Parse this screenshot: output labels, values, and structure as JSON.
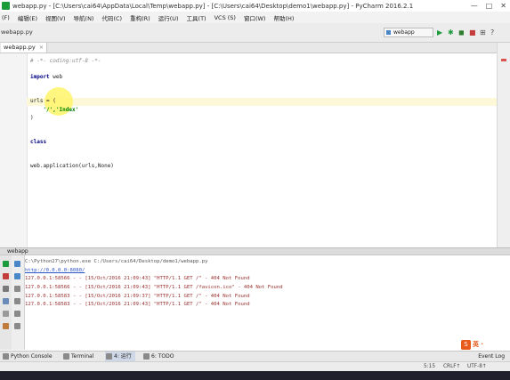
{
  "titlebar": {
    "title": "webapp.py - [C:\\Users\\cai64\\AppData\\Local\\Temp\\webapp.py] - [C:\\Users\\cai64\\Desktop\\demo1\\webapp.py] - PyCharm 2016.2.1",
    "buttons": [
      "—",
      "□",
      "✕"
    ]
  },
  "menubar": [
    "(F)",
    "编辑(E)",
    "视图(V)",
    "导航(N)",
    "代码(C)",
    "重构(R)",
    "运行(U)",
    "工具(T)",
    "VCS (S)",
    "窗口(W)",
    "帮助(H)"
  ],
  "toolbar": {
    "breadcrumb": "webapp.py",
    "run_config": "webapp",
    "icons": [
      "run-icon",
      "debug-icon",
      "coverage-icon",
      "stop-icon",
      "vcs-icon",
      "settings-icon"
    ]
  },
  "editor": {
    "tab_label": "webapp.py",
    "tab_close": "×",
    "lines": [
      {
        "kind": "comment",
        "text": "# -*- coding:utf-8 -*-"
      },
      {
        "kind": "blank",
        "text": ""
      },
      {
        "kind": "import",
        "kw": "import",
        "rest": " web"
      },
      {
        "kind": "blank",
        "text": ""
      },
      {
        "kind": "blank",
        "text": ""
      },
      {
        "kind": "plain",
        "text": "urls = ("
      },
      {
        "kind": "string",
        "text": "    '/','Index'"
      },
      {
        "kind": "plain",
        "text": ")"
      },
      {
        "kind": "blank",
        "text": ""
      },
      {
        "kind": "blank",
        "text": ""
      },
      {
        "kind": "class",
        "kw": "class",
        "rest": " "
      },
      {
        "kind": "blank",
        "text": ""
      },
      {
        "kind": "blank",
        "text": ""
      },
      {
        "kind": "plain",
        "text": "web.application(urls,None)"
      }
    ]
  },
  "run_panel": {
    "header": "webapp",
    "lines": [
      {
        "kind": "plain",
        "text": "C:\\Python27\\python.exe C:/Users/cai64/Desktop/demo1/webapp.py"
      },
      {
        "kind": "link",
        "text": "http://0.0.0.0:8080/"
      },
      {
        "kind": "err",
        "text": "127.0.0.1:58566 - - [15/Oct/2016 21:09:43] \"HTTP/1.1 GET /\" - 404 Not Found"
      },
      {
        "kind": "err",
        "text": "127.0.0.1:58566 - - [15/Oct/2016 21:09:43] \"HTTP/1.1 GET /favicon.ico\" - 404 Not Found"
      },
      {
        "kind": "err",
        "text": "127.0.0.1:58583 - - [15/Oct/2016 21:09:37] \"HTTP/1.1 GET /\" - 404 Not Found"
      },
      {
        "kind": "err",
        "text": "127.0.0.1:58583 - - [15/Oct/2016 21:09:43] \"HTTP/1.1 GET /\" - 404 Not Found"
      }
    ]
  },
  "bottom_tabs": [
    {
      "label": "Python Console",
      "active": false
    },
    {
      "label": "Terminal",
      "active": false
    },
    {
      "label": "4: 运行",
      "active": true
    },
    {
      "label": "6: TODO",
      "active": false
    }
  ],
  "event_log": "Event Log",
  "watermark": {
    "badge": "S",
    "text": "英 ·"
  },
  "statusbar": {
    "position": "5:15",
    "line_sep": "CRLF↑",
    "encoding": "UTF-8↑"
  },
  "colors": {
    "accent": "#4a87c8",
    "run_green": "#1b9b3b",
    "keyword": "#000080",
    "string": "#008000",
    "error": "#9b2f2f",
    "watermark": "#e85a1c"
  }
}
